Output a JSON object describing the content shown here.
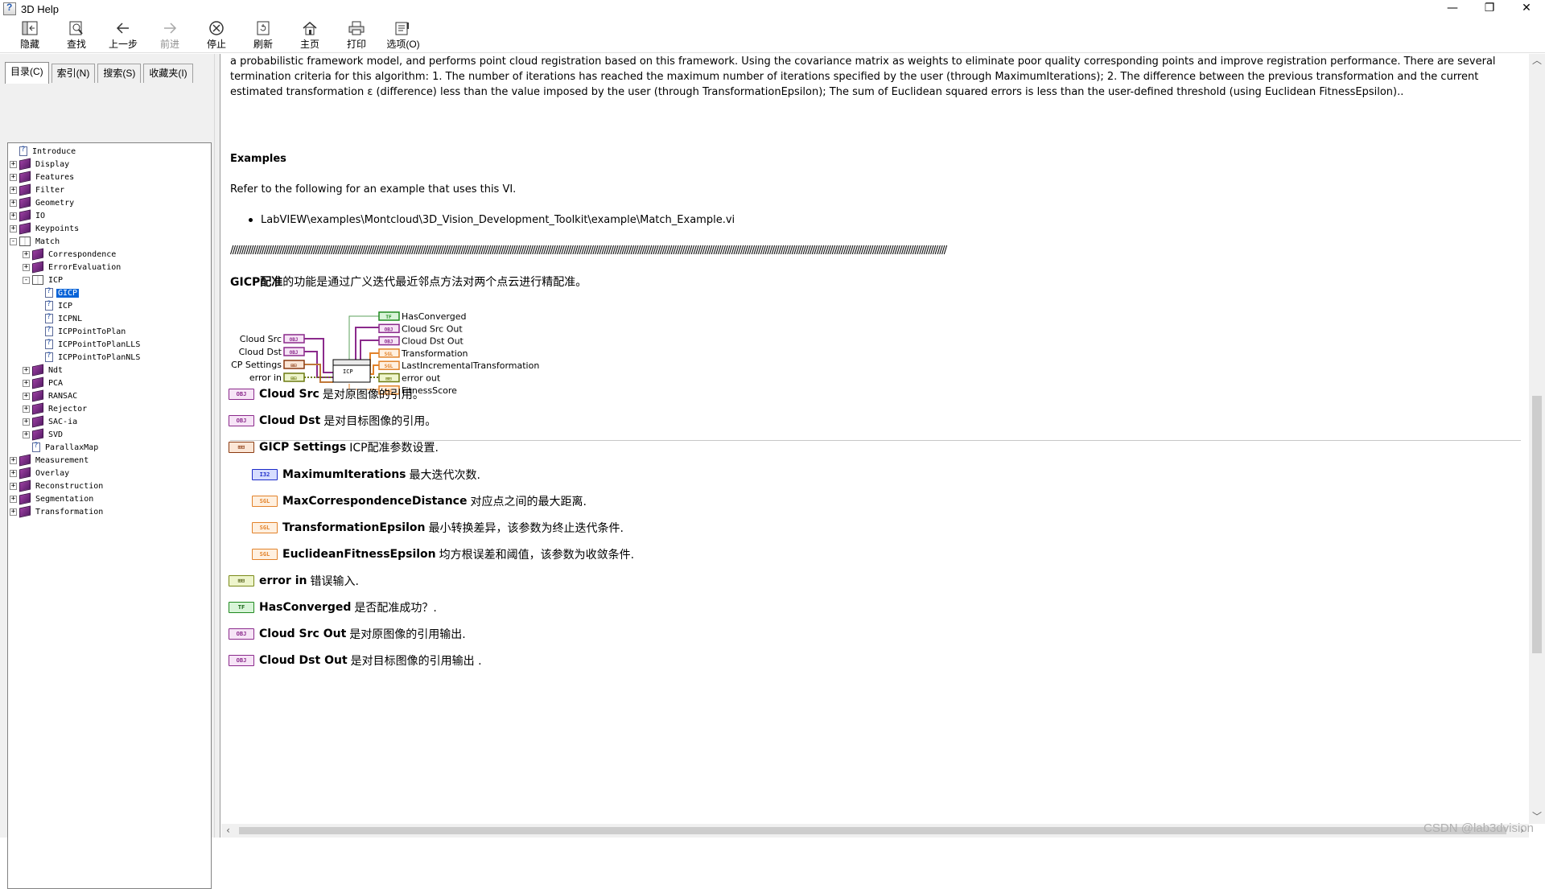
{
  "window": {
    "title": "3D Help",
    "controls": [
      "—",
      "❐",
      "✕"
    ]
  },
  "toolbar": [
    {
      "label": "隐藏",
      "icon": "hide-icon",
      "enabled": true
    },
    {
      "label": "查找",
      "icon": "find-icon",
      "enabled": true
    },
    {
      "label": "上一步",
      "icon": "back-icon",
      "enabled": true
    },
    {
      "label": "前进",
      "icon": "forward-icon",
      "enabled": false
    },
    {
      "label": "停止",
      "icon": "stop-icon",
      "enabled": true
    },
    {
      "label": "刷新",
      "icon": "refresh-icon",
      "enabled": true
    },
    {
      "label": "主页",
      "icon": "home-icon",
      "enabled": true
    },
    {
      "label": "打印",
      "icon": "print-icon",
      "enabled": true
    },
    {
      "label": "选项(O)",
      "icon": "options-icon",
      "enabled": true
    }
  ],
  "nav": {
    "tabs": [
      {
        "label": "目录(C)",
        "active": true
      },
      {
        "label": "索引(N)",
        "active": false
      },
      {
        "label": "搜索(S)",
        "active": false
      },
      {
        "label": "收藏夹(I)",
        "active": false
      }
    ],
    "tree": [
      {
        "label": "Introduce",
        "level": 0,
        "type": "page",
        "exp": ""
      },
      {
        "label": "Display",
        "level": 0,
        "type": "book",
        "exp": "+"
      },
      {
        "label": "Features",
        "level": 0,
        "type": "book",
        "exp": "+"
      },
      {
        "label": "Filter",
        "level": 0,
        "type": "book",
        "exp": "+"
      },
      {
        "label": "Geometry",
        "level": 0,
        "type": "book",
        "exp": "+"
      },
      {
        "label": "IO",
        "level": 0,
        "type": "book",
        "exp": "+"
      },
      {
        "label": "Keypoints",
        "level": 0,
        "type": "book",
        "exp": "+"
      },
      {
        "label": "Match",
        "level": 0,
        "type": "open",
        "exp": "-"
      },
      {
        "label": "Correspondence",
        "level": 1,
        "type": "book",
        "exp": "+"
      },
      {
        "label": "ErrorEvaluation",
        "level": 1,
        "type": "book",
        "exp": "+"
      },
      {
        "label": "ICP",
        "level": 1,
        "type": "open",
        "exp": "-"
      },
      {
        "label": "GICP",
        "level": 2,
        "type": "page",
        "exp": "",
        "selected": true
      },
      {
        "label": "ICP",
        "level": 2,
        "type": "page",
        "exp": ""
      },
      {
        "label": "ICPNL",
        "level": 2,
        "type": "page",
        "exp": ""
      },
      {
        "label": "ICPPointToPlan",
        "level": 2,
        "type": "page",
        "exp": ""
      },
      {
        "label": "ICPPointToPlanLLS",
        "level": 2,
        "type": "page",
        "exp": ""
      },
      {
        "label": "ICPPointToPlanNLS",
        "level": 2,
        "type": "page",
        "exp": ""
      },
      {
        "label": "Ndt",
        "level": 1,
        "type": "book",
        "exp": "+"
      },
      {
        "label": "PCA",
        "level": 1,
        "type": "book",
        "exp": "+"
      },
      {
        "label": "RANSAC",
        "level": 1,
        "type": "book",
        "exp": "+"
      },
      {
        "label": "Rejector",
        "level": 1,
        "type": "book",
        "exp": "+"
      },
      {
        "label": "SAC-ia",
        "level": 1,
        "type": "book",
        "exp": "+"
      },
      {
        "label": "SVD",
        "level": 1,
        "type": "book",
        "exp": "+"
      },
      {
        "label": "ParallaxMap",
        "level": 1,
        "type": "page",
        "exp": ""
      },
      {
        "label": "Measurement",
        "level": 0,
        "type": "book",
        "exp": "+"
      },
      {
        "label": "Overlay",
        "level": 0,
        "type": "book",
        "exp": "+"
      },
      {
        "label": "Reconstruction",
        "level": 0,
        "type": "book",
        "exp": "+"
      },
      {
        "label": "Segmentation",
        "level": 0,
        "type": "book",
        "exp": "+"
      },
      {
        "label": "Transformation",
        "level": 0,
        "type": "book",
        "exp": "+"
      }
    ]
  },
  "content": {
    "intro_paragraph": "a probabilistic framework model, and performs point cloud registration based on this framework. Using the covariance matrix as weights to eliminate poor quality corresponding points and improve registration performance. There are several termination criteria for this algorithm: 1. The number of iterations has reached the maximum number of iterations specified by the user (through MaximumIterations); 2. The difference between the previous transformation and the current estimated transformation ε (difference) less than the value imposed by the user (through TransformationEpsilon); The sum of Euclidean squared errors is less than the user-defined threshold (using Euclidean FitnessEpsilon)..",
    "examples_heading": "Examples",
    "examples_refer": "Refer to the following for an example that uses this VI.",
    "example_path": "LabVIEW\\examples\\Montcloud\\3D_Vision_Development_Toolkit\\example\\Match_Example.vi",
    "separator": "////////////////////////////////////////////////////////////////////////////////////////////////////////////////////////////////////////////////////////////////////////////////////////////////////////////////////////////////////////////////////////////////////////////////////////////////////////////////////////////////",
    "cn_title_bold": "GICP配准",
    "cn_title_rest": "的功能是通过广义迭代最近邻点方法对两个点云进行精配准。",
    "diagram": {
      "inputs": [
        "Cloud Src",
        "Cloud Dst",
        "GICP Settings",
        "error in"
      ],
      "outputs": [
        "HasConverged",
        "Cloud Src Out",
        "Cloud Dst Out",
        "Transformation",
        "LastIncrementalTransformation",
        "error out",
        "FitnessScore"
      ],
      "node_label": "ICP",
      "input_badges": [
        "OBJ",
        "OBJ",
        "⊞⊟",
        "⊞⊟"
      ],
      "output_badges": [
        "TF",
        "OBJ",
        "OBJ",
        "SGL",
        "SGL",
        "⊞⊟",
        "SGL"
      ]
    },
    "terms": [
      {
        "badge": "OBJ",
        "kind": "obj",
        "name": "Cloud Src",
        "desc": " 是对原图像的引用。",
        "indent": 0
      },
      {
        "badge": "OBJ",
        "kind": "obj",
        "name": "Cloud Dst",
        "desc": " 是对目标图像的引用。",
        "indent": 0
      },
      {
        "badge": "⊞⊟",
        "kind": "clu",
        "name": "GICP Settings",
        "desc": "ICP配准参数设置.",
        "indent": 0
      },
      {
        "badge": "I32",
        "kind": "i32",
        "name": "MaximumIterations",
        "desc": "最大迭代次数.",
        "indent": 1
      },
      {
        "badge": "SGL",
        "kind": "sgl",
        "name": "MaxCorrespondenceDistance",
        "desc": "对应点之间的最大距离.",
        "indent": 1
      },
      {
        "badge": "SGL",
        "kind": "sgl",
        "name": "TransformationEpsilon",
        "desc": "最小转换差异，该参数为终止迭代条件.",
        "indent": 1
      },
      {
        "badge": "SGL",
        "kind": "sgl",
        "name": "EuclideanFitnessEpsilon",
        "desc": "均方根误差和阈值，该参数为收敛条件.",
        "indent": 1
      },
      {
        "badge": "⊞⊟",
        "kind": "err",
        "name": "error in",
        "desc": "错误输入.",
        "indent": 0
      },
      {
        "badge": "TF",
        "kind": "tf",
        "name": "HasConverged",
        "desc": "是否配准成功？.",
        "indent": 0
      },
      {
        "badge": "OBJ",
        "kind": "obj",
        "name": "Cloud Src Out",
        "desc": " 是对原图像的引用输出.",
        "indent": 0
      },
      {
        "badge": "OBJ",
        "kind": "obj",
        "name": "Cloud Dst Out",
        "desc": " 是对目标图像的引用输出 .",
        "indent": 0
      }
    ]
  },
  "watermark": "CSDN @lab3dvision",
  "colors": {
    "selection": "#0a64d8",
    "obj": "#8b2a8c",
    "sgl": "#e2822a",
    "i32": "#1d2cc9",
    "bool": "#1f8a1f",
    "error": "#7a8a18"
  }
}
